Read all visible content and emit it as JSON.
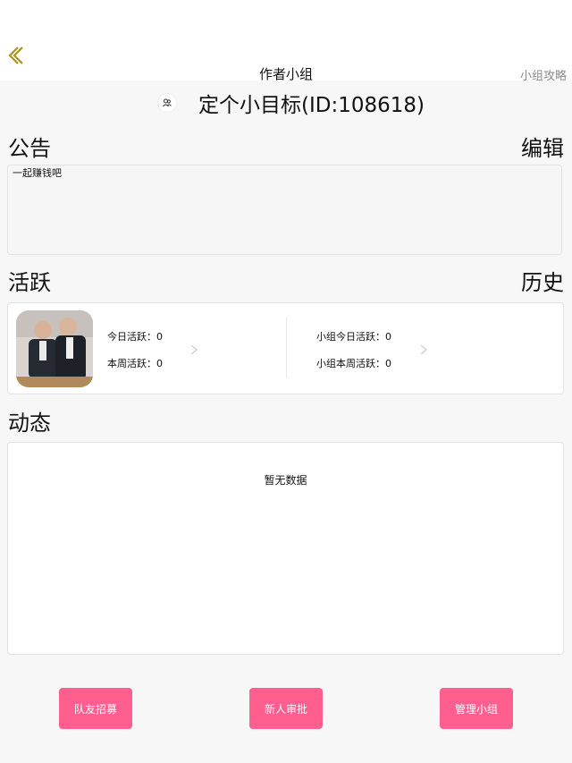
{
  "nav": {
    "title": "作者小组",
    "guide_link": "小组攻略"
  },
  "group": {
    "name": "定个小目标(ID:108618)"
  },
  "notice": {
    "title": "公告",
    "edit_label": "编辑",
    "text": "一起赚钱吧"
  },
  "activity": {
    "title": "活跃",
    "history_label": "历史",
    "personal": {
      "today": "今日活跃：0",
      "week": "本周活跃：0"
    },
    "group": {
      "today": "小组今日活跃：0",
      "week": "小组本周活跃：0"
    }
  },
  "feed": {
    "title": "动态",
    "empty": "暂无数据"
  },
  "buttons": {
    "recruit": "队友招募",
    "review": "新人审批",
    "manage": "管理小组"
  },
  "colors": {
    "accent": "#ff5f8f",
    "back_icon": "#a99422"
  },
  "icons": {
    "back": "chevron-left-icon",
    "group": "group-icon",
    "arrow": "chevron-right-icon"
  }
}
